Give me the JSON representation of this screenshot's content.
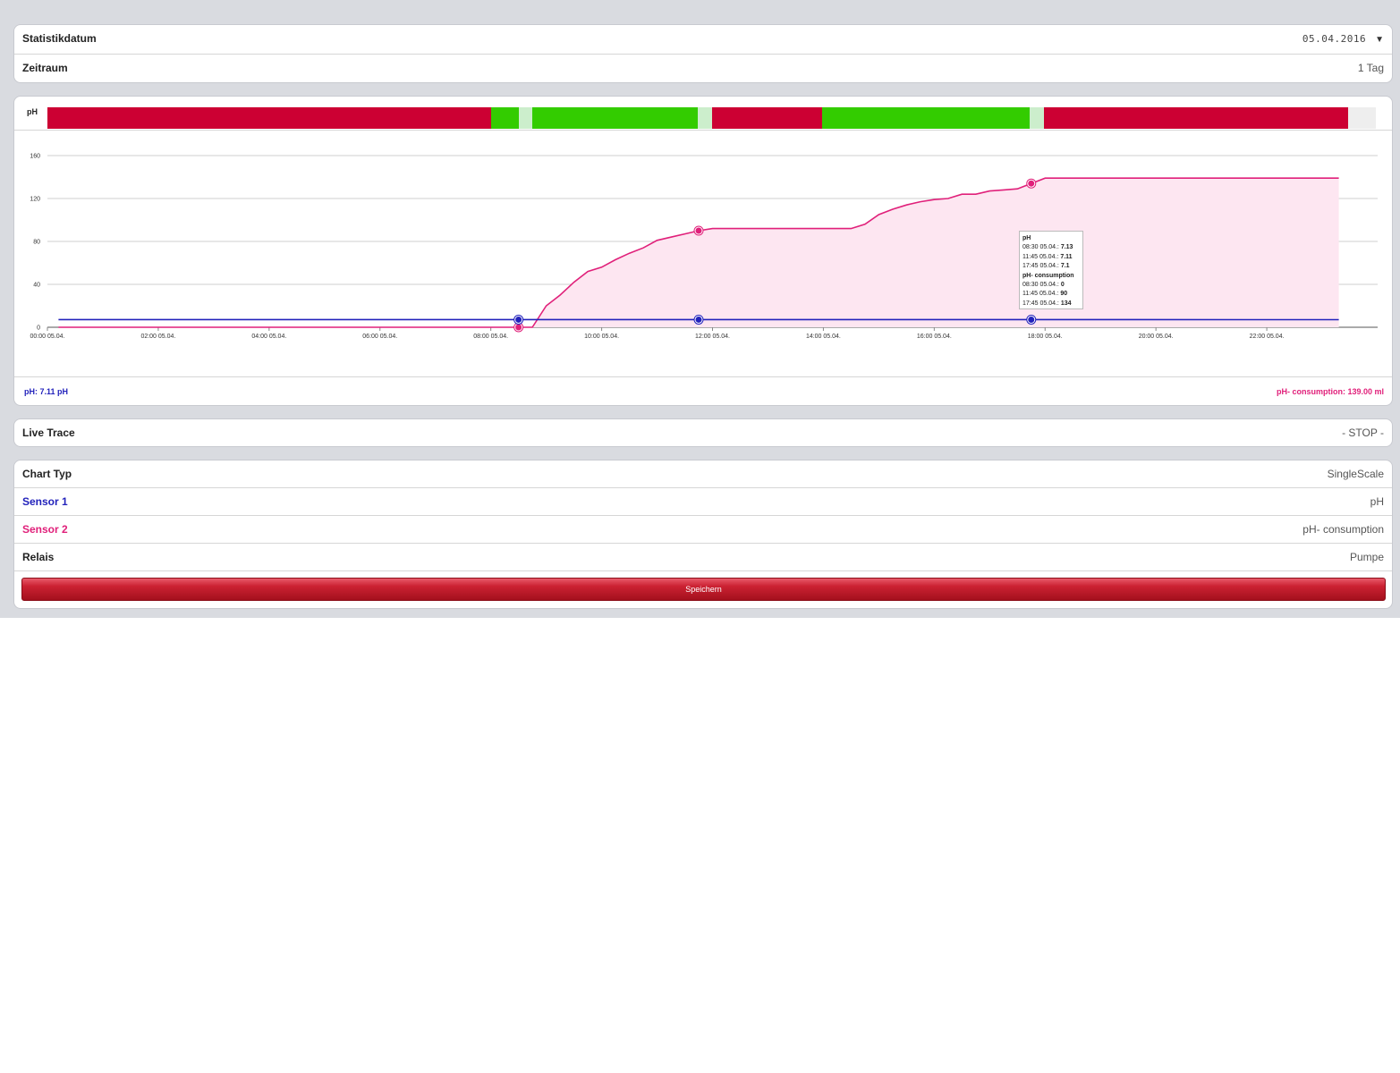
{
  "header": {
    "date_label": "Statistikdatum",
    "date_value": "05.04.2016",
    "period_label": "Zeitraum",
    "period_value": "1 Tag"
  },
  "relay_band": {
    "label": "pH",
    "segments": [
      {
        "from": 0.0,
        "to": 10.42,
        "state": "off"
      },
      {
        "from": 10.42,
        "to": 11.07,
        "state": "on"
      },
      {
        "from": 11.07,
        "to": 11.39,
        "state": "light"
      },
      {
        "from": 11.39,
        "to": 15.27,
        "state": "on"
      },
      {
        "from": 15.27,
        "to": 15.6,
        "state": "light"
      },
      {
        "from": 15.6,
        "to": 18.19,
        "state": "off"
      },
      {
        "from": 18.19,
        "to": 23.07,
        "state": "on"
      },
      {
        "from": 23.07,
        "to": 23.4,
        "state": "light"
      },
      {
        "from": 23.4,
        "to": 30.54,
        "state": "off"
      },
      {
        "from": 30.54,
        "to": 31.2,
        "state": "none"
      }
    ],
    "colors": {
      "off": "#cc0033",
      "on": "#33cc00",
      "light": "#cceecc",
      "none": "#eeeeee"
    }
  },
  "chart_data": {
    "type": "area",
    "ylim": [
      0,
      160
    ],
    "yticks": [
      0,
      40,
      80,
      120,
      160
    ],
    "xlim": [
      0,
      24
    ],
    "x_ticks": [
      "00:00 05.04.",
      "02:00 05.04.",
      "04:00 05.04.",
      "06:00 05.04.",
      "08:00 05.04.",
      "10:00 05.04.",
      "12:00 05.04.",
      "14:00 05.04.",
      "16:00 05.04.",
      "18:00 05.04.",
      "20:00 05.04.",
      "22:00 05.04."
    ],
    "series": [
      {
        "name": "pH",
        "color": "#2222bb",
        "x": [
          0.2,
          8.5,
          23.3
        ],
        "values": [
          7.13,
          7.13,
          7.1
        ]
      },
      {
        "name": "pH- consumption",
        "color": "#e0207a",
        "x": [
          0.2,
          8.5,
          8.75,
          9.0,
          9.25,
          9.5,
          9.75,
          10.0,
          10.25,
          10.5,
          10.75,
          11.0,
          11.25,
          11.5,
          11.75,
          12.0,
          12.5,
          13.0,
          13.5,
          14.0,
          14.5,
          14.75,
          15.0,
          15.25,
          15.5,
          15.75,
          16.0,
          16.25,
          16.5,
          16.75,
          17.0,
          17.25,
          17.5,
          17.75,
          18.0,
          18.25,
          23.3
        ],
        "values": [
          0,
          0,
          0,
          20,
          30,
          42,
          52,
          56,
          63,
          69,
          74,
          81,
          84,
          87,
          90,
          92,
          92,
          92,
          92,
          92,
          92,
          96,
          105,
          110,
          114,
          117,
          119,
          120,
          124,
          124,
          127,
          128,
          129,
          134,
          139,
          139,
          139
        ]
      }
    ],
    "markers": [
      8.5,
      11.75,
      17.75
    ]
  },
  "tooltip": {
    "s1_name": "pH",
    "s1_r1_time": "08:30 05.04.:",
    "s1_r1_val": "7.13",
    "s1_r2_time": "11:45 05.04.:",
    "s1_r2_val": "7.11",
    "s1_r3_time": "17:45 05.04.:",
    "s1_r3_val": "7.1",
    "s2_name": "pH- consumption",
    "s2_r1_time": "08:30 05.04.:",
    "s2_r1_val": "0",
    "s2_r2_time": "11:45 05.04.:",
    "s2_r2_val": "90",
    "s2_r3_time": "17:45 05.04.:",
    "s2_r3_val": "134"
  },
  "chart_footer": {
    "left": "pH: 7.11 pH",
    "right": "pH- consumption: 139.00 ml"
  },
  "live_trace": {
    "label": "Live Trace",
    "value": "- STOP -"
  },
  "settings": {
    "chart_type_label": "Chart Typ",
    "chart_type_value": "SingleScale",
    "sensor1_label": "Sensor 1",
    "sensor1_value": "pH",
    "sensor1_color": "#2222bb",
    "sensor2_label": "Sensor 2",
    "sensor2_value": "pH- consumption",
    "sensor2_color": "#e0207a",
    "relay_label": "Relais",
    "relay_value": "Pumpe",
    "save_label": "Speichern"
  }
}
